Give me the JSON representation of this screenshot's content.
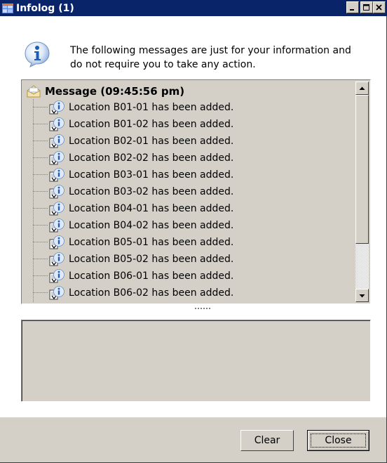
{
  "window": {
    "title": "Infolog (1)",
    "caption_buttons": {
      "minimize": "_",
      "maximize": "□",
      "close": "✕"
    }
  },
  "info": {
    "icon": "info-icon",
    "text": "The following messages are just for your information and do not require you to take any action."
  },
  "tree": {
    "root": {
      "icon": "envelope-icon",
      "label": "Message (09:45:56 pm)"
    },
    "items": [
      {
        "icon": "info-doc-icon",
        "label": "Location B01-01 has been added."
      },
      {
        "icon": "info-doc-icon",
        "label": "Location B01-02 has been added."
      },
      {
        "icon": "info-doc-icon",
        "label": "Location B02-01 has been added."
      },
      {
        "icon": "info-doc-icon",
        "label": "Location B02-02 has been added."
      },
      {
        "icon": "info-doc-icon",
        "label": "Location B03-01 has been added."
      },
      {
        "icon": "info-doc-icon",
        "label": "Location B03-02 has been added."
      },
      {
        "icon": "info-doc-icon",
        "label": "Location B04-01 has been added."
      },
      {
        "icon": "info-doc-icon",
        "label": "Location B04-02 has been added."
      },
      {
        "icon": "info-doc-icon",
        "label": "Location B05-01 has been added."
      },
      {
        "icon": "info-doc-icon",
        "label": "Location B05-02 has been added."
      },
      {
        "icon": "info-doc-icon",
        "label": "Location B06-01 has been added."
      },
      {
        "icon": "info-doc-icon",
        "label": "Location B06-02 has been added."
      }
    ]
  },
  "buttons": {
    "clear": "Clear",
    "close": "Close"
  },
  "colors": {
    "title_bar": "#0a246a",
    "face": "#d4d0c8",
    "info_blue": "#1a5fb4"
  }
}
